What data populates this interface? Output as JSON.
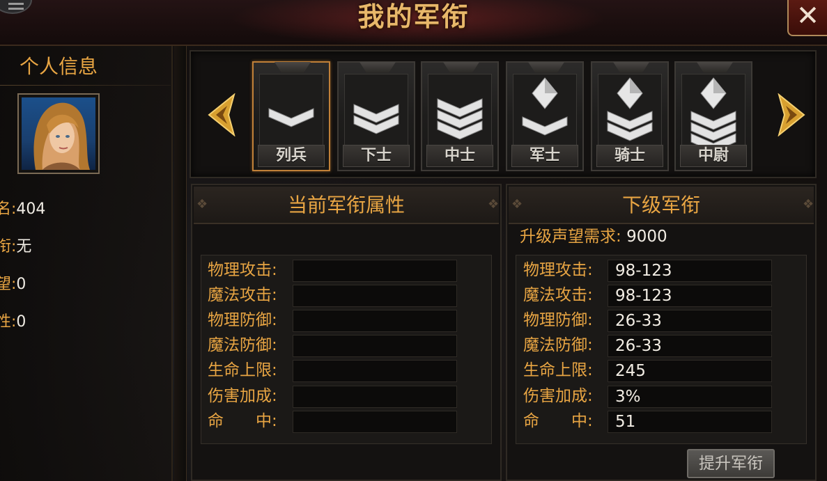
{
  "title": "我的军衔",
  "left_panel": {
    "header": "个人信息",
    "stats": [
      {
        "label": "名:",
        "value": "404"
      },
      {
        "label": "衔:",
        "value": "无"
      },
      {
        "label": "望:",
        "value": "0"
      },
      {
        "label": "性:",
        "value": "0"
      }
    ]
  },
  "ranks": [
    {
      "name": "列兵",
      "chevrons": 1,
      "diamond": false,
      "selected": true
    },
    {
      "name": "下士",
      "chevrons": 2,
      "diamond": false,
      "selected": false
    },
    {
      "name": "中士",
      "chevrons": 3,
      "diamond": false,
      "selected": false
    },
    {
      "name": "军士",
      "chevrons": 1,
      "diamond": true,
      "selected": false
    },
    {
      "name": "骑士",
      "chevrons": 2,
      "diamond": true,
      "selected": false
    },
    {
      "name": "中尉",
      "chevrons": 3,
      "diamond": true,
      "selected": false
    }
  ],
  "current_panel": {
    "title": "当前军衔属性",
    "attrs": [
      {
        "label": "物理攻击:",
        "value": ""
      },
      {
        "label": "魔法攻击:",
        "value": ""
      },
      {
        "label": "物理防御:",
        "value": ""
      },
      {
        "label": "魔法防御:",
        "value": ""
      },
      {
        "label": "生命上限:",
        "value": ""
      },
      {
        "label": "伤害加成:",
        "value": ""
      },
      {
        "label": "命　　中:",
        "value": ""
      }
    ]
  },
  "next_panel": {
    "title": "下级军衔",
    "requirement_label": "升级声望需求:",
    "requirement_value": "9000",
    "attrs": [
      {
        "label": "物理攻击:",
        "value": "98-123"
      },
      {
        "label": "魔法攻击:",
        "value": "98-123"
      },
      {
        "label": "物理防御:",
        "value": "26-33"
      },
      {
        "label": "魔法防御:",
        "value": "26-33"
      },
      {
        "label": "生命上限:",
        "value": "245"
      },
      {
        "label": "伤害加成:",
        "value": "3%"
      },
      {
        "label": "命　　中:",
        "value": "51"
      }
    ]
  },
  "upgrade_button": "提升军衔",
  "icons": {
    "menu": "menu-icon",
    "close": "close-icon",
    "prev": "arrow-left-icon",
    "next": "arrow-right-icon"
  },
  "colors": {
    "accent": "#e8a543",
    "title": "#e8b86a",
    "selected_border": "#c08038"
  }
}
